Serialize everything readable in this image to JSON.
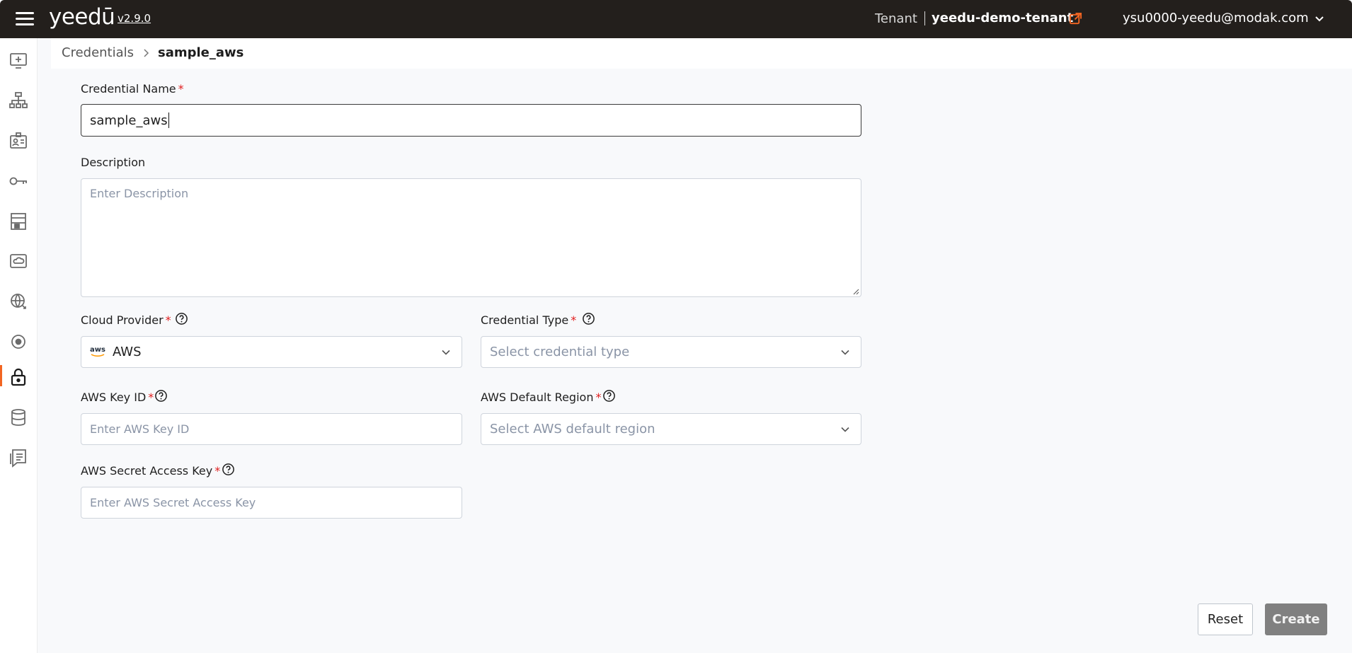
{
  "header": {
    "logo": "yeedū",
    "version": "v2.9.0",
    "tenant_label": "Tenant",
    "tenant_name": "yeedu-demo-tenant",
    "user_email": "ysu0000-yeedu@modak.com"
  },
  "sidebar": {
    "items": [
      {
        "icon": "add-workspace-icon"
      },
      {
        "icon": "org-chart-icon"
      },
      {
        "icon": "id-badge-icon"
      },
      {
        "icon": "key-icon"
      },
      {
        "icon": "building-icon"
      },
      {
        "icon": "cloud-icon"
      },
      {
        "icon": "globe-icon"
      },
      {
        "icon": "target-icon"
      },
      {
        "icon": "lock-icon",
        "active": true
      },
      {
        "icon": "database-icon"
      },
      {
        "icon": "receipt-icon"
      }
    ],
    "accent_color": "#f26522"
  },
  "breadcrumb": {
    "parent": "Credentials",
    "current": "sample_aws"
  },
  "form": {
    "credential_name": {
      "label": "Credential Name",
      "required": "*",
      "value": "sample_aws"
    },
    "description": {
      "label": "Description",
      "placeholder": "Enter Description"
    },
    "cloud_provider": {
      "label": "Cloud Provider",
      "required": "*",
      "value": "AWS",
      "provider_badge": "aws"
    },
    "credential_type": {
      "label": "Credential Type",
      "required": "*",
      "placeholder": "Select credential type"
    },
    "aws_key_id": {
      "label": "AWS Key ID",
      "required": "*",
      "placeholder": "Enter AWS Key ID"
    },
    "aws_default_region": {
      "label": "AWS Default Region",
      "required": "*",
      "placeholder": "Select AWS default region"
    },
    "aws_secret_access_key": {
      "label": "AWS Secret Access Key",
      "required": "*",
      "placeholder": "Enter AWS Secret Access Key"
    }
  },
  "actions": {
    "reset_label": "Reset",
    "create_label": "Create"
  }
}
